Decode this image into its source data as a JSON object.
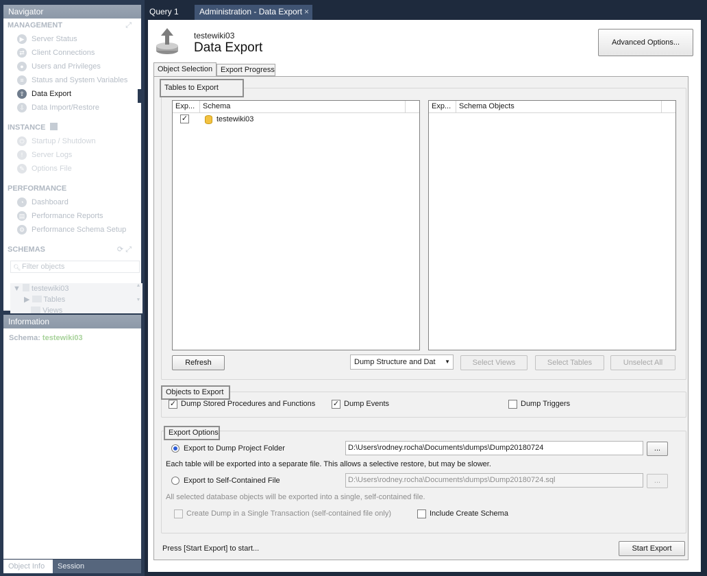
{
  "navigator": {
    "title": "Navigator",
    "management": {
      "heading": "MANAGEMENT",
      "items": [
        "Server Status",
        "Client Connections",
        "Users and Privileges",
        "Status and System Variables",
        "Data Export",
        "Data Import/Restore"
      ]
    },
    "instance": {
      "heading": "INSTANCE",
      "items": [
        "Startup / Shutdown",
        "Server Logs",
        "Options File"
      ]
    },
    "performance": {
      "heading": "PERFORMANCE",
      "items": [
        "Dashboard",
        "Performance Reports",
        "Performance Schema Setup"
      ]
    },
    "schemas": {
      "heading": "SCHEMAS",
      "filter_placeholder": "Filter objects",
      "tree": [
        "testewiki03",
        "Tables",
        "Views"
      ]
    }
  },
  "information": {
    "title": "Information",
    "schema_label": "Schema:",
    "schema_value": "testewiki03"
  },
  "bottom_tabs": [
    "Object Info",
    "Session"
  ],
  "tabs": [
    "Query 1",
    "Administration - Data Export"
  ],
  "header": {
    "subtitle": "testewiki03",
    "title": "Data Export",
    "advanced_button": "Advanced Options..."
  },
  "subtabs": [
    "Object Selection",
    "Export Progress"
  ],
  "tables_to_export": {
    "title": "Tables to Export",
    "left_columns": [
      "Exp...",
      "Schema"
    ],
    "right_columns": [
      "Exp...",
      "Schema Objects"
    ],
    "schemas": [
      {
        "name": "testewiki03",
        "checked": true
      }
    ],
    "refresh_button": "Refresh",
    "dump_select": "Dump Structure and Dat",
    "select_views_button": "Select Views",
    "select_tables_button": "Select Tables",
    "unselect_all_button": "Unselect All"
  },
  "objects_to_export": {
    "title": "Objects to Export",
    "routines": "Dump Stored Procedures and Functions",
    "events": "Dump Events",
    "triggers": "Dump Triggers"
  },
  "export_options": {
    "title": "Export Options",
    "folder_label": "Export to Dump Project Folder",
    "folder_path": "D:\\Users\\rodney.rocha\\Documents\\dumps\\Dump20180724",
    "folder_note": "Each table will be exported into a separate file. This allows a selective restore, but may be slower.",
    "file_label": "Export to Self-Contained File",
    "file_path": "D:\\Users\\rodney.rocha\\Documents\\dumps\\Dump20180724.sql",
    "file_note": "All selected database objects will be exported into a single, self-contained file.",
    "single_transaction": "Create Dump in a Single Transaction (self-contained file only)",
    "include_schema": "Include Create Schema",
    "browse_button": "..."
  },
  "footer": {
    "status": "Press [Start Export] to start...",
    "start_button": "Start Export"
  }
}
